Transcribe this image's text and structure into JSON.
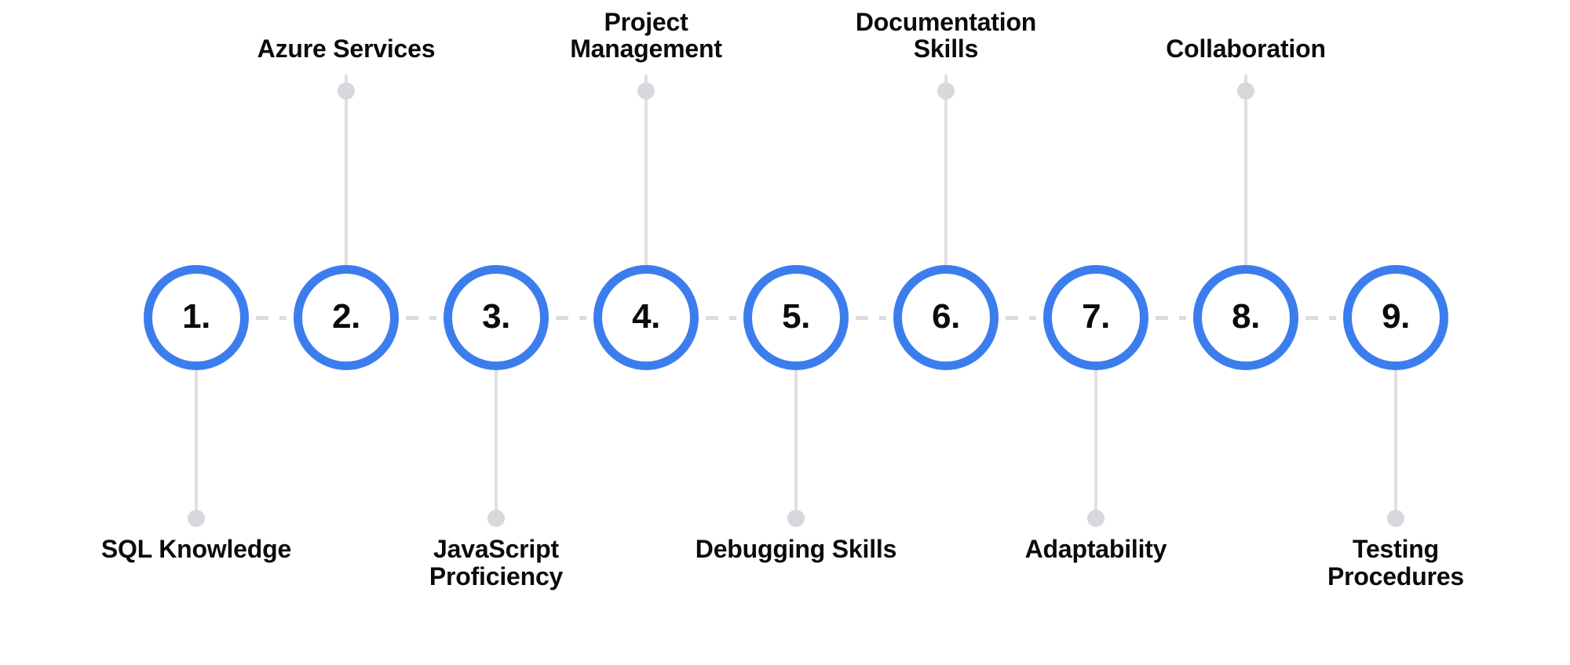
{
  "diagram": {
    "type": "numbered-timeline",
    "orientation": "horizontal",
    "node_count": 9,
    "colors": {
      "accent_blue": "#3C7DEE",
      "connector_gray": "#DCDCDE",
      "stem_gray": "#E0E0E3",
      "dot_gray": "#D7D8DC",
      "text_black": "#0B0B0F",
      "background": "#FFFFFF"
    },
    "nodes": [
      {
        "number": "1.",
        "label": "SQL Knowledge",
        "label_position": "below"
      },
      {
        "number": "2.",
        "label": "Azure Services",
        "label_position": "above"
      },
      {
        "number": "3.",
        "label": "JavaScript\nProficiency",
        "label_position": "below"
      },
      {
        "number": "4.",
        "label": "Project\nManagement",
        "label_position": "above"
      },
      {
        "number": "5.",
        "label": "Debugging Skills",
        "label_position": "below"
      },
      {
        "number": "6.",
        "label": "Documentation\nSkills",
        "label_position": "above"
      },
      {
        "number": "7.",
        "label": "Adaptability",
        "label_position": "below"
      },
      {
        "number": "8.",
        "label": "Collaboration",
        "label_position": "above"
      },
      {
        "number": "9.",
        "label": "Testing\nProcedures",
        "label_position": "below"
      }
    ]
  }
}
